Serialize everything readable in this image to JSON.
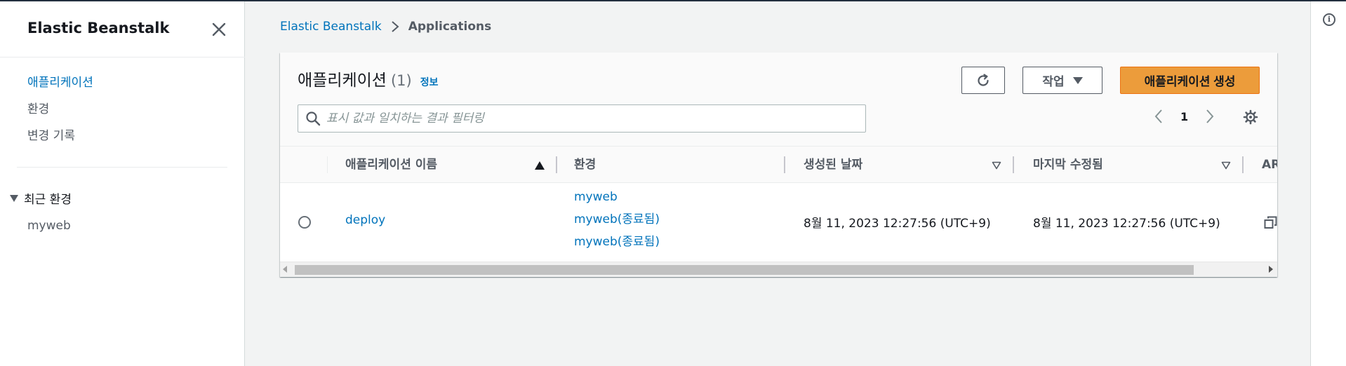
{
  "sidebar": {
    "title": "Elastic Beanstalk",
    "items": [
      {
        "label": "애플리케이션",
        "active": true
      },
      {
        "label": "환경",
        "active": false
      },
      {
        "label": "변경 기록",
        "active": false
      }
    ],
    "recent_label": "최근 환경",
    "recent_items": [
      "myweb"
    ]
  },
  "breadcrumb": {
    "root": "Elastic Beanstalk",
    "current": "Applications"
  },
  "panel": {
    "title": "애플리케이션",
    "count": "(1)",
    "info": "정보",
    "actions_label": "작업",
    "create_label": "애플리케이션 생성",
    "search_placeholder": "표시 값과 일치하는 결과 필터링",
    "page": "1"
  },
  "table": {
    "columns": [
      "애플리케이션 이름",
      "환경",
      "생성된 날짜",
      "마지막 수정됨",
      "AR"
    ],
    "rows": [
      {
        "name": "deploy",
        "environments": [
          "myweb",
          "myweb(종료됨)",
          "myweb(종료됨)"
        ],
        "created": "8월 11, 2023 12:27:56 (UTC+9)",
        "modified": "8월 11, 2023 12:27:56 (UTC+9)"
      }
    ]
  },
  "colors": {
    "link": "#0073bb",
    "primary_button": "#ec9c3b",
    "text": "#16191f",
    "muted": "#545b64"
  }
}
